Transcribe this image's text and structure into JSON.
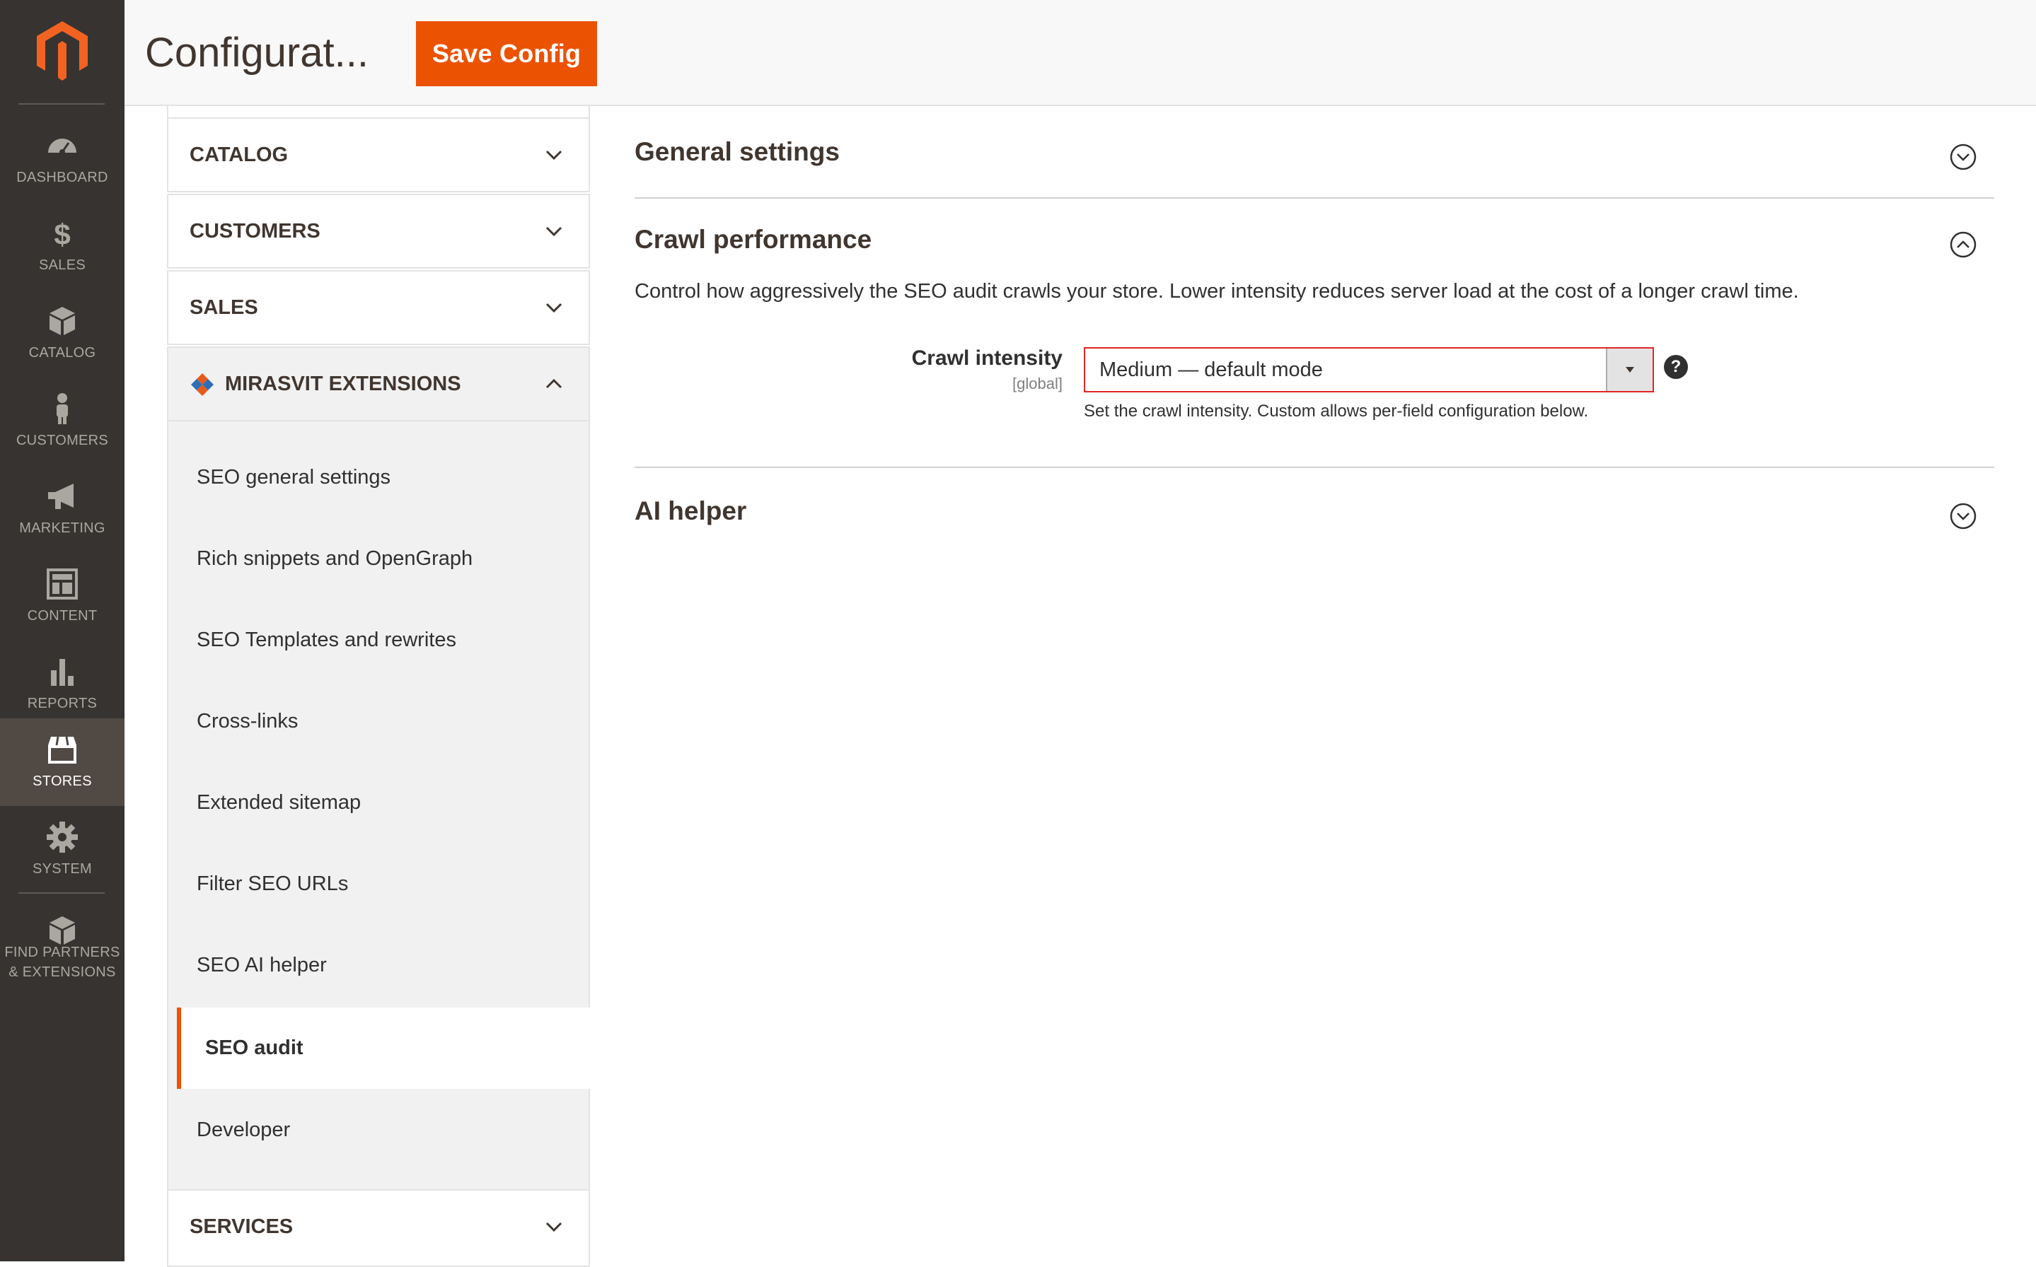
{
  "admin_nav": {
    "items": [
      {
        "label": "DASHBOARD",
        "icon": "dashboard-icon"
      },
      {
        "label": "SALES",
        "icon": "dollar-icon"
      },
      {
        "label": "CATALOG",
        "icon": "box-icon"
      },
      {
        "label": "CUSTOMERS",
        "icon": "person-icon"
      },
      {
        "label": "MARKETING",
        "icon": "megaphone-icon"
      },
      {
        "label": "CONTENT",
        "icon": "layout-icon"
      },
      {
        "label": "REPORTS",
        "icon": "bar-chart-icon"
      },
      {
        "label": "STORES",
        "icon": "store-icon",
        "active": true
      },
      {
        "label": "SYSTEM",
        "icon": "gear-icon"
      },
      {
        "label_line1": "FIND PARTNERS",
        "label_line2": "& EXTENSIONS",
        "icon": "extensions-icon"
      }
    ]
  },
  "header": {
    "title": "Configurat...",
    "save_label": "Save Config"
  },
  "tabs": {
    "groups": [
      {
        "label": "CATALOG",
        "expanded": false
      },
      {
        "label": "CUSTOMERS",
        "expanded": false
      },
      {
        "label": "SALES",
        "expanded": false
      },
      {
        "label": "MIRASVIT EXTENSIONS",
        "expanded": true
      },
      {
        "label": "SERVICES",
        "expanded": false
      }
    ],
    "mirasvit_items": [
      {
        "label": "SEO general settings"
      },
      {
        "label": "Rich snippets and OpenGraph"
      },
      {
        "label": "SEO Templates and rewrites"
      },
      {
        "label": "Cross-links"
      },
      {
        "label": "Extended sitemap"
      },
      {
        "label": "Filter SEO URLs"
      },
      {
        "label": "SEO AI helper"
      },
      {
        "label": "SEO audit",
        "active": true
      },
      {
        "label": "Developer"
      }
    ]
  },
  "main": {
    "sections": [
      {
        "title": "General settings",
        "expanded": false
      },
      {
        "title": "Crawl performance",
        "expanded": true
      },
      {
        "title": "AI helper",
        "expanded": false
      }
    ],
    "crawl": {
      "description": "Control how aggressively the SEO audit crawls your store. Lower intensity reduces server load at the cost of a longer crawl time.",
      "field_label": "Crawl intensity",
      "field_scope": "[global]",
      "select_value": "Medium — default mode",
      "help_symbol": "?",
      "note": "Set the crawl intensity. Custom allows per-field configuration below."
    }
  },
  "colors": {
    "nav_bg": "#373330",
    "nav_active": "#514943",
    "accent": "#eb5202",
    "error_border": "#e22626"
  }
}
